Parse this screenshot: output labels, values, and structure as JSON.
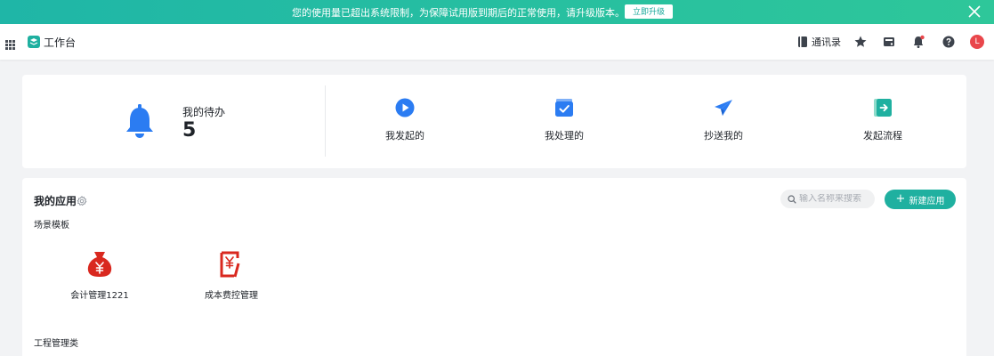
{
  "banner": {
    "text": "您的使用量已超出系统限制，为保障试用版到期后的正常使用，请升级版本。",
    "upgrade_label": "立即升级",
    "color": "#21bca3"
  },
  "topbar": {
    "app_title": "工作台",
    "contacts_label": "通讯录",
    "avatar_letter": "L",
    "icons": [
      "grid-icon",
      "logo-icon",
      "contacts-icon",
      "star-icon",
      "inbox-icon",
      "bell-icon",
      "help-icon"
    ]
  },
  "summary": {
    "todo_label": "我的待办",
    "todo_count": "5",
    "quick_actions": [
      {
        "label": "我发起的",
        "icon": "play-icon"
      },
      {
        "label": "我处理的",
        "icon": "check-box-icon"
      },
      {
        "label": "抄送我的",
        "icon": "paper-plane-icon"
      },
      {
        "label": "发起流程",
        "icon": "start-flow-icon"
      }
    ]
  },
  "apps": {
    "title": "我的应用",
    "search_placeholder": "输入名称来搜索",
    "new_app_label": "新建应用",
    "sections": [
      {
        "title": "场景模板",
        "items": [
          {
            "label": "会计管理1221",
            "icon": "money-bag-icon"
          },
          {
            "label": "成本费控管理",
            "icon": "receipt-icon"
          }
        ]
      },
      {
        "title": "工程管理类",
        "items": []
      }
    ]
  },
  "colors": {
    "accent": "#1fb0a0",
    "blue": "#2b7cf2",
    "red": "#d9281f",
    "avatar": "#e9464b"
  }
}
